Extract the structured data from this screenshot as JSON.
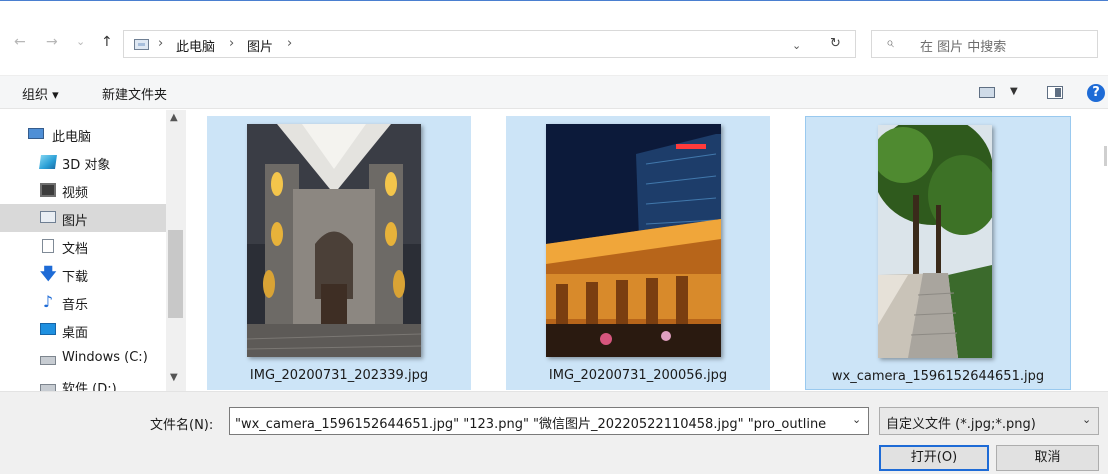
{
  "address": {
    "crumbs": [
      "此电脑",
      "图片"
    ],
    "separator": "›",
    "search_placeholder": "在 图片 中搜索",
    "back_glyph": "←",
    "forward_glyph": "→",
    "recent_glyph": "⌄",
    "up_glyph": "↑",
    "dropdown_glyph": "⌄",
    "refresh_glyph": "↻",
    "search_glyph": "⌕"
  },
  "toolbar": {
    "organize": "组织 ▾",
    "new_folder": "新建文件夹",
    "view_dropdown_glyph": "▼",
    "help_glyph": "?"
  },
  "nav": {
    "items": [
      {
        "label": "此电脑",
        "icon": "pc-icon"
      },
      {
        "label": "3D 对象",
        "icon": "3d-objects-icon"
      },
      {
        "label": "视频",
        "icon": "video-icon"
      },
      {
        "label": "图片",
        "icon": "pictures-icon",
        "selected": true
      },
      {
        "label": "文档",
        "icon": "documents-icon"
      },
      {
        "label": "下载",
        "icon": "download-icon"
      },
      {
        "label": "音乐",
        "icon": "music-icon"
      },
      {
        "label": "桌面",
        "icon": "desktop-icon"
      },
      {
        "label": "Windows (C:)",
        "icon": "drive-icon"
      },
      {
        "label": "软件 (D:)",
        "icon": "drive-icon"
      }
    ],
    "download_glyph": "🡇",
    "music_glyph": "♪",
    "scroll_up_glyph": "▲",
    "scroll_down_glyph": "▼"
  },
  "files": [
    {
      "name": "IMG_20200731_202339.jpg",
      "selected": true
    },
    {
      "name": "IMG_20200731_200056.jpg",
      "selected": true
    },
    {
      "name": "wx_camera_1596152644651.jpg",
      "selected": true
    }
  ],
  "bottom": {
    "filename_label": "文件名(N):",
    "filename_value": "\"wx_camera_1596152644651.jpg\" \"123.png\" \"微信图片_20220522110458.jpg\" \"pro_outline",
    "filetype_value": "自定义文件 (*.jpg;*.png)",
    "dropdown_glyph": "⌄",
    "open_label": "打开(O)",
    "cancel_label": "取消"
  },
  "colors": {
    "selection": "#cce4f7",
    "accent": "#1e6bd6"
  }
}
